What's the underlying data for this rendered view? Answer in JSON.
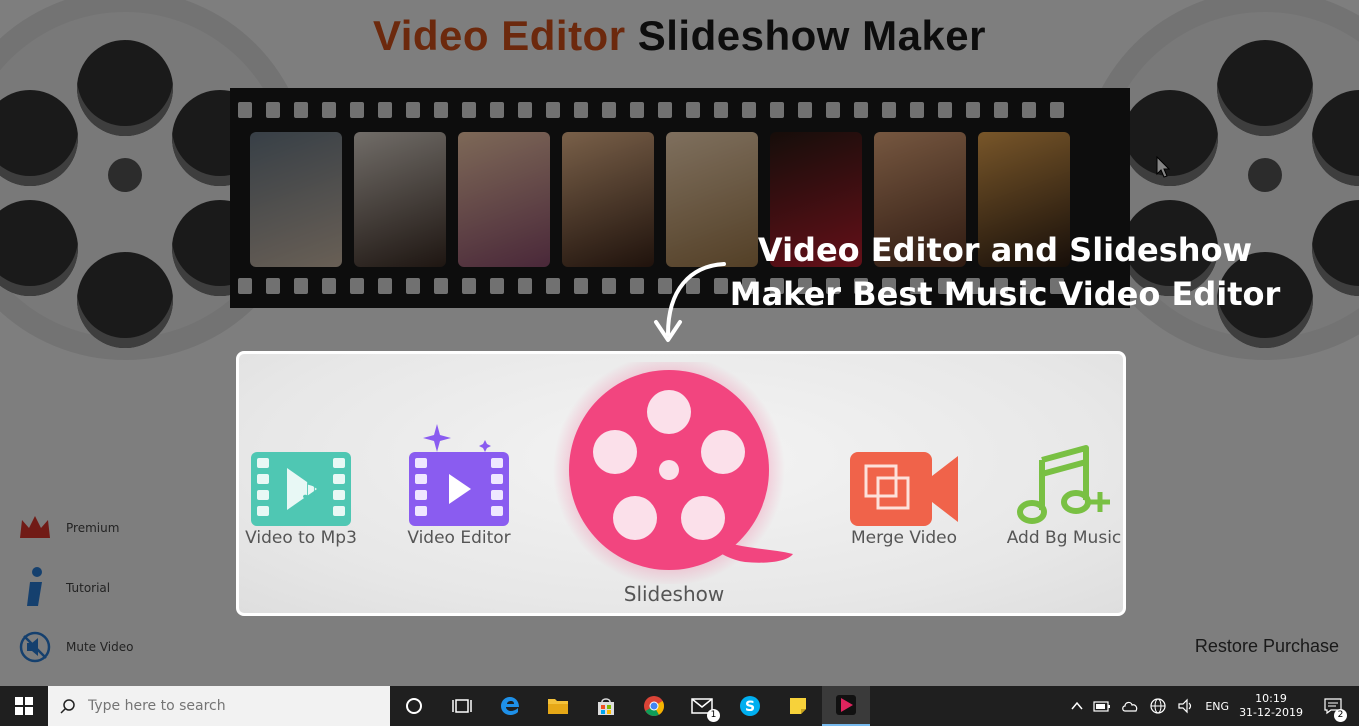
{
  "app": {
    "title_part1": "Video Editor",
    "title_part2": "Slideshow Maker",
    "sidebar": [
      {
        "label": "Premium"
      },
      {
        "label": "Tutorial"
      },
      {
        "label": "Mute Video"
      }
    ],
    "restore_purchase": "Restore Purchase"
  },
  "callout": {
    "line1": "Video Editor and Slideshow",
    "line2": "Maker Best Music Video Editor"
  },
  "tools": {
    "video_to_mp3": "Video to Mp3",
    "video_editor": "Video Editor",
    "slideshow": "Slideshow",
    "merge_video": "Merge Video",
    "add_bg_music": "Add Bg Music"
  },
  "taskbar": {
    "search_placeholder": "Type here to search",
    "mail_badge": "1",
    "language": "ENG",
    "time": "10:19",
    "date": "31-12-2019",
    "notification_count": "2"
  },
  "colors": {
    "title_accent": "#d0501a",
    "slideshow_pink": "#f2457f",
    "teal": "#4fc7b3",
    "purple": "#8a5cf0",
    "orange": "#f0634a",
    "green": "#79c043"
  }
}
